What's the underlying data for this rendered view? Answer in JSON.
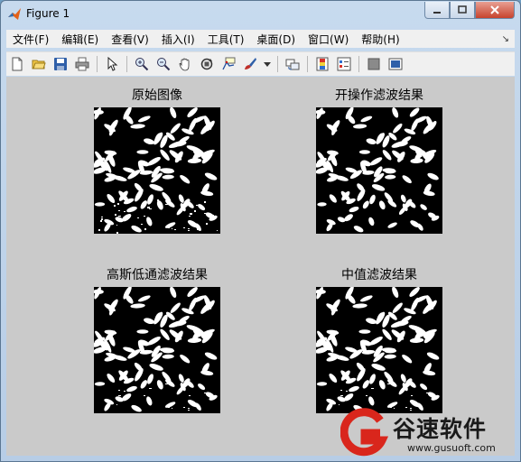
{
  "window": {
    "title": "Figure 1"
  },
  "menu": [
    "文件(F)",
    "编辑(E)",
    "查看(V)",
    "插入(I)",
    "工具(T)",
    "桌面(D)",
    "窗口(W)",
    "帮助(H)"
  ],
  "toolbar": {
    "groups": [
      [
        "new-file-icon",
        "open-folder-icon",
        "save-icon",
        "print-icon"
      ],
      [
        "pointer-icon"
      ],
      [
        "zoom-in-icon",
        "zoom-out-icon",
        "pan-hand-icon",
        "rotate-3d-icon",
        "data-cursor-icon",
        "brush-icon",
        "brush-dropdown-icon"
      ],
      [
        "link-plot-icon"
      ],
      [
        "colorbar-icon",
        "legend-icon"
      ],
      [
        "hide-plot-tools-icon",
        "show-plot-tools-icon"
      ]
    ]
  },
  "subplots": [
    {
      "title": "原始图像"
    },
    {
      "title": "开操作滤波结果"
    },
    {
      "title": "高斯低通滤波结果"
    },
    {
      "title": "中值滤波结果"
    }
  ],
  "watermark": {
    "brand": "谷速软件",
    "url": "www.gusuoft.com"
  },
  "colors": {
    "figure_bg": "#cacaca",
    "watermark_red": "#d9261c",
    "title_bar": "#c7daee"
  }
}
